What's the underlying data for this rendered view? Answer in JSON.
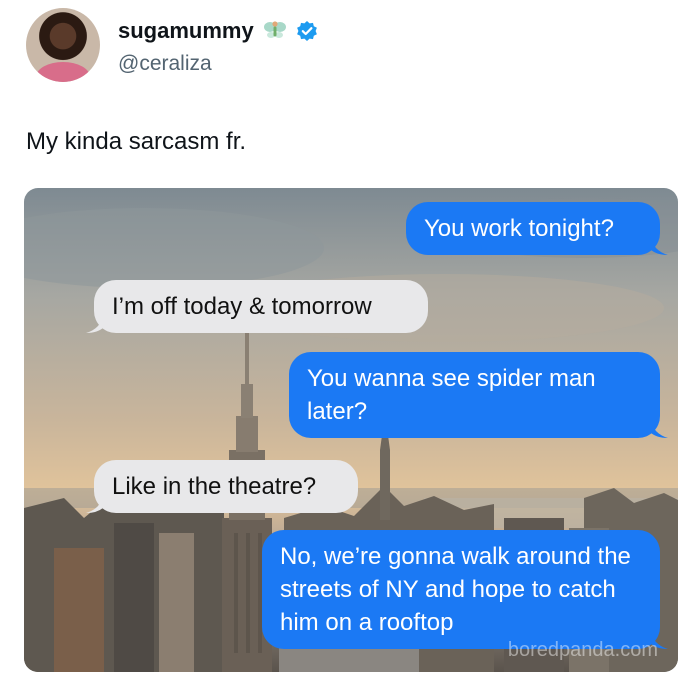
{
  "tweet": {
    "display_name": "sugamummy",
    "handle": "@ceraliza",
    "text": "My kinda sarcasm fr.",
    "badge_icons": [
      "fairy-icon",
      "verified-badge-icon"
    ],
    "verified_color": "#1d9bf0"
  },
  "messages": [
    {
      "side": "outgoing",
      "text": "You work tonight?"
    },
    {
      "side": "incoming",
      "text": "I’m off today & tomorrow"
    },
    {
      "side": "outgoing",
      "text": "You wanna see spider man later?"
    },
    {
      "side": "incoming",
      "text": "Like in the theatre?"
    },
    {
      "side": "outgoing",
      "text": "No, we’re gonna walk around the streets of NY and hope to catch him on a rooftop"
    }
  ],
  "colors": {
    "outgoing_bubble": "#1b79f4",
    "incoming_bubble": "#e8e8ea"
  },
  "watermark": "boredpanda.com"
}
